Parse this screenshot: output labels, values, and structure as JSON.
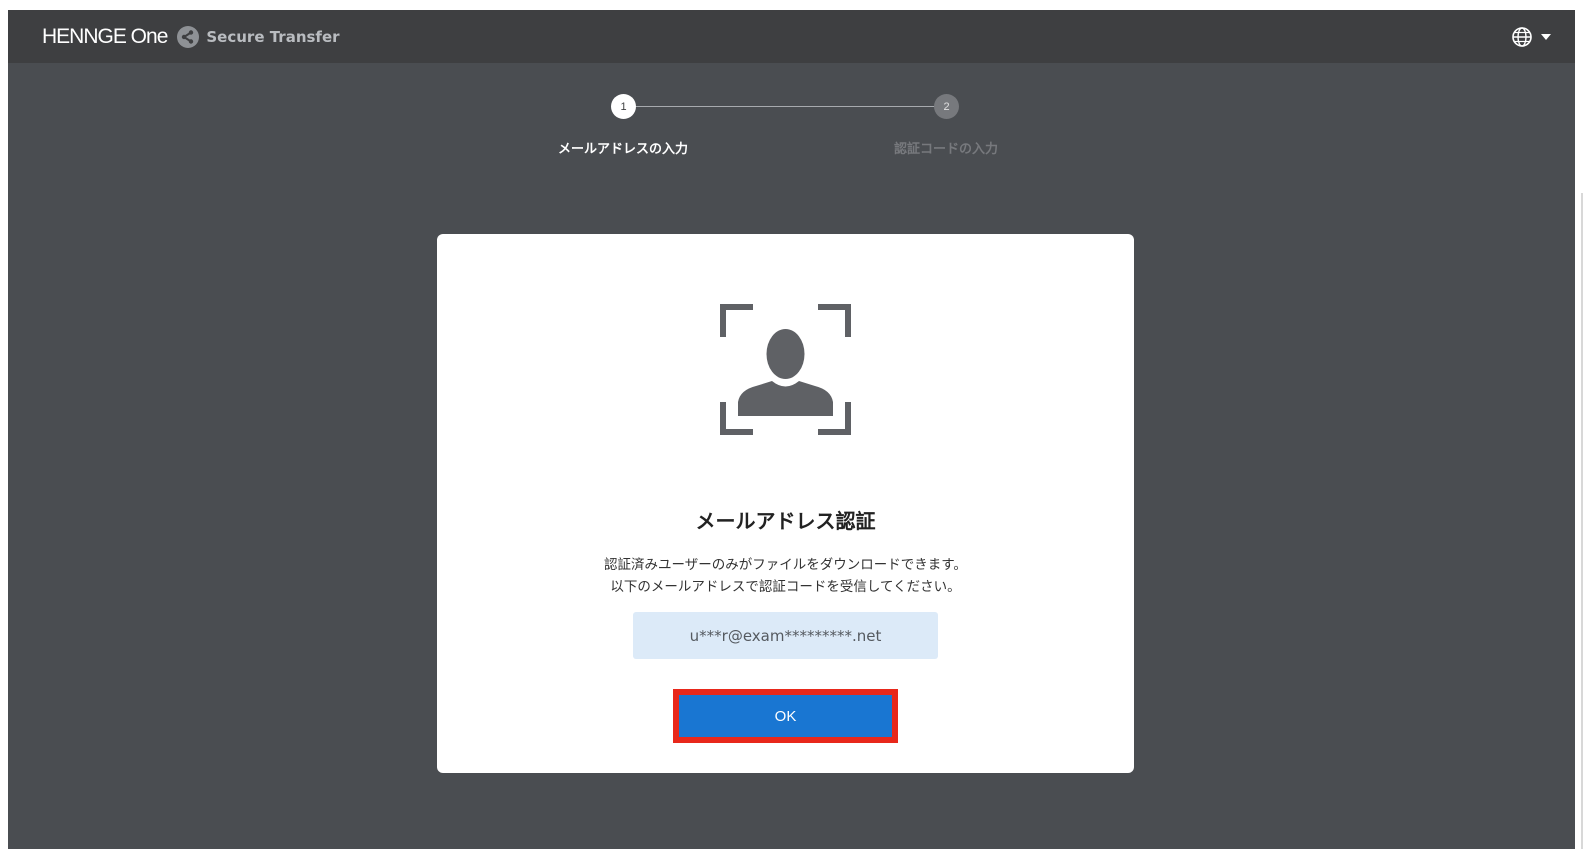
{
  "header": {
    "brand": "HENNGE One",
    "product": "Secure Transfer",
    "language_icon": "globe-icon",
    "dropdown_icon": "caret-down-icon"
  },
  "stepper": {
    "steps": [
      {
        "number": "1",
        "label": "メールアドレスの入力",
        "active": true
      },
      {
        "number": "2",
        "label": "認証コードの入力",
        "active": false
      }
    ]
  },
  "card": {
    "icon": "user-scan-icon",
    "title": "メールアドレス認証",
    "description_line1": "認証済みユーザーのみがファイルをダウンロードできます。",
    "description_line2": "以下のメールアドレスで認証コードを受信してください。",
    "email": "u***r@exam*********.net",
    "ok_label": "OK"
  },
  "colors": {
    "background": "#4a4d51",
    "topbar": "#3e3f41",
    "primary_button": "#1976d2",
    "highlight_border": "#e8281b",
    "email_box": "#dceaf8"
  }
}
